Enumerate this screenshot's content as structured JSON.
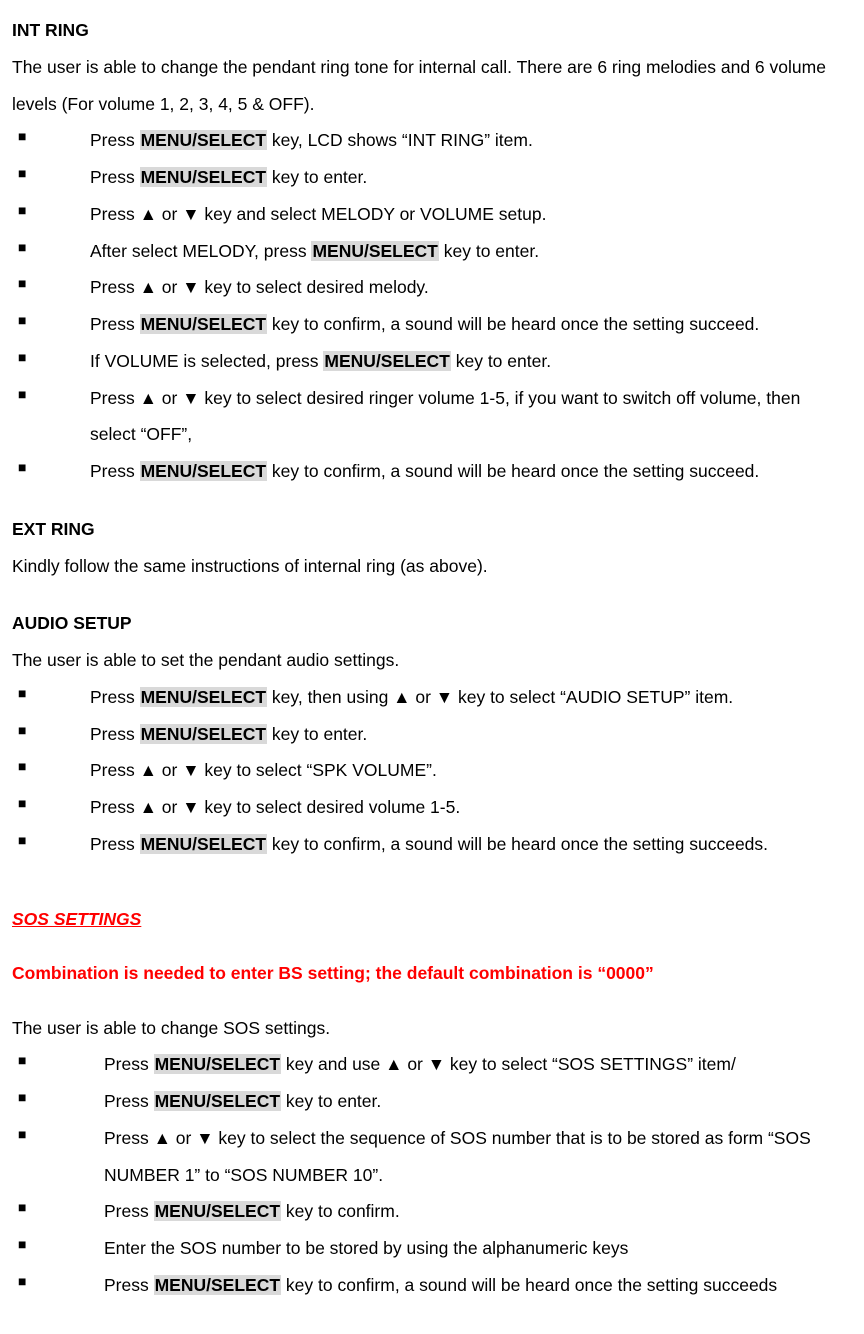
{
  "hl_menu": "MENU/SELECT",
  "intRing": {
    "heading": "INT RING",
    "intro": "The user is able to change the pendant ring tone for internal call. There are 6 ring melodies and 6 volume levels (For volume 1, 2, 3, 4, 5 & OFF).",
    "items": [
      {
        "pre": "Press ",
        "hl": true,
        "post": " key, LCD shows “INT RING” item."
      },
      {
        "pre": "Press ",
        "hl": true,
        "post": " key to enter."
      },
      {
        "pre": "Press ▲ or ▼ key and select MELODY or VOLUME setup.",
        "hl": false,
        "post": ""
      },
      {
        "pre": "After select MELODY, press ",
        "hl": true,
        "post": " key to enter."
      },
      {
        "pre": "Press ▲ or ▼ key to select desired melody.",
        "hl": false,
        "post": ""
      },
      {
        "pre": "Press ",
        "hl": true,
        "post": " key to confirm, a sound will be heard once the setting succeed."
      },
      {
        "pre": "If VOLUME is selected, press ",
        "hl": true,
        "post": " key to enter."
      },
      {
        "pre": "Press ▲ or ▼ key to select desired ringer volume 1-5, if you want to switch off volume, then select “OFF”,",
        "hl": false,
        "post": ""
      },
      {
        "pre": "Press ",
        "hl": true,
        "post": " key to confirm, a sound will be heard once the setting succeed."
      }
    ]
  },
  "extRing": {
    "heading": "EXT RING",
    "body": "Kindly follow the same instructions of internal ring (as above)."
  },
  "audioSetup": {
    "heading": "AUDIO SETUP",
    "intro": "The user is able to set the pendant audio settings.",
    "items": [
      {
        "pre": "Press ",
        "hl": true,
        "post": " key, then using ▲ or ▼ key to select “AUDIO SETUP” item."
      },
      {
        "pre": "Press ",
        "hl": true,
        "post": " key to enter."
      },
      {
        "pre": "Press ▲ or ▼ key to select “SPK VOLUME”.",
        "hl": false,
        "post": ""
      },
      {
        "pre": "Press ▲ or ▼ key to select desired volume 1-5.",
        "hl": false,
        "post": ""
      },
      {
        "pre": "Press ",
        "hl": true,
        "post": " key to confirm, a sound will be heard once the setting succeeds."
      }
    ]
  },
  "sos": {
    "title": "SOS SETTINGS",
    "sub": "Combination is needed to enter BS setting; the default combination is “0000”",
    "intro": "The user is able to change SOS settings.",
    "items": [
      {
        "pre": "Press ",
        "hl": true,
        "post": " key and use ▲ or ▼ key to select “SOS SETTINGS” item/"
      },
      {
        "pre": "Press ",
        "hl": true,
        "post": " key to enter."
      },
      {
        "pre": "Press ▲ or ▼ key to select the sequence of SOS number that is to be stored as form “SOS NUMBER 1” to “SOS NUMBER 10”.",
        "hl": false,
        "post": ""
      },
      {
        "pre": "Press ",
        "hl": true,
        "post": " key to confirm."
      },
      {
        "pre": "Enter the SOS number to be stored by using the alphanumeric keys",
        "hl": false,
        "post": ""
      },
      {
        "pre": "Press ",
        "hl": true,
        "post": " key to confirm, a sound will be heard once the setting succeeds"
      }
    ]
  }
}
